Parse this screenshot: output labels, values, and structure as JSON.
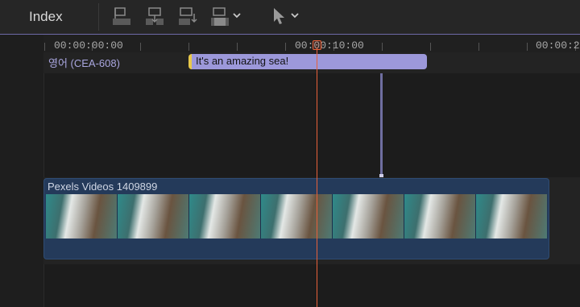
{
  "toolbar": {
    "index_label": "Index",
    "icons": [
      "connect-clip-icon",
      "insert-clip-icon",
      "append-clip-icon",
      "overwrite-clip-icon",
      "select-tool-icon"
    ]
  },
  "ruler": {
    "timecodes": [
      "00:00:00:00",
      "00:00:10:00",
      "00:00:2"
    ]
  },
  "caption_lane": {
    "label": "영어 (CEA-608)",
    "clip_text": "It's an amazing sea!"
  },
  "video_clip": {
    "name": "Pexels Videos 1409899"
  },
  "colors": {
    "accent": "#6e6aa8",
    "caption_clip": "#9c98da",
    "video_clip": "#243a5a",
    "playhead": "#e8603a"
  }
}
